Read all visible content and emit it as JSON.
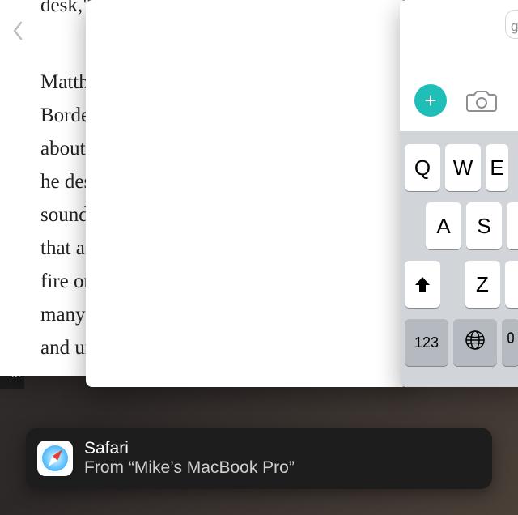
{
  "reader": {
    "paragraph1": "desk,\" s",
    "paragraph2_lines": [
      "Matthe",
      "Borderl",
      "about a",
      "he desc",
      "sound:",
      "that as",
      "fire on",
      "many p",
      "and un"
    ]
  },
  "url_bar": {
    "partial_text": "g"
  },
  "tools": {
    "add_label": "+"
  },
  "keyboard": {
    "row1": [
      "Q",
      "W",
      "E"
    ],
    "row2": [
      "A",
      "S"
    ],
    "row3": [
      "Z"
    ],
    "numbers_key": "123"
  },
  "dark_band": {
    "letter": "M"
  },
  "handoff": {
    "app_name": "Safari",
    "subtitle": "From “Mike’s MacBook Pro”"
  }
}
